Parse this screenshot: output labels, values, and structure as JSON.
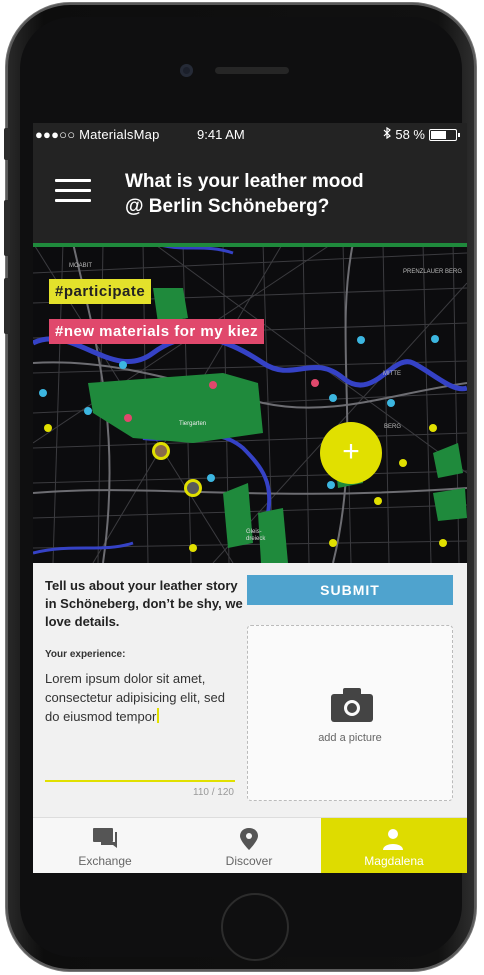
{
  "status_bar": {
    "carrier": "●●●○○ MaterialsMap",
    "time": "9:41 AM",
    "battery": "58 %",
    "icons": [
      "wifi-icon",
      "bluetooth-icon",
      "battery-icon"
    ]
  },
  "header": {
    "title": "What is your leather mood\n@ Berlin Schöneberg?",
    "menu_icon": "hamburger-icon"
  },
  "map": {
    "tags": [
      "#participate",
      "#new materials for my kiez"
    ],
    "labels": [
      "MOABIT",
      "PRENZLAUER BERG",
      "MITTE",
      "Tiergarten",
      "BERG",
      "Gleis-\ndreieck"
    ],
    "add_icon": "plus-icon",
    "fab_label": "+"
  },
  "form": {
    "prompt": "Tell us about your leather story in Schöneberg, don’t be shy, we love details.",
    "experience_label": "Your experience:",
    "experience_text": "Lorem ipsum dolor sit amet, consectetur adipisicing elit, sed do eiusmod tempor",
    "counter": "110 / 120",
    "submit_label": "SUBMIT",
    "picture_label": "add a picture",
    "picture_icon": "camera-icon"
  },
  "tabs": [
    {
      "label": "Exchange",
      "icon": "chat-icon"
    },
    {
      "label": "Discover",
      "icon": "location-pin-icon"
    },
    {
      "label": "Magdalena",
      "icon": "user-icon"
    }
  ],
  "colors": {
    "accent_yellow": "#dedc00",
    "tag_pink": "#e0486c",
    "submit_blue": "#4fa3ce",
    "header_bg": "#232323"
  }
}
